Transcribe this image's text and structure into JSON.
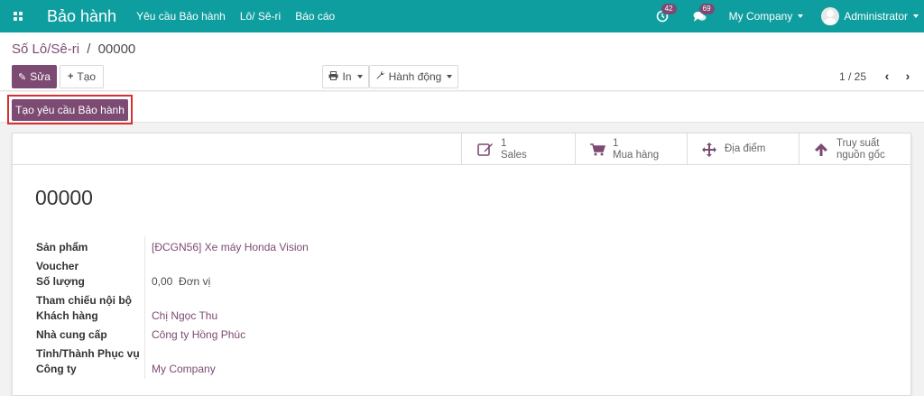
{
  "navbar": {
    "brand": "Bảo hành",
    "menu": [
      "Yêu cầu Bảo hành",
      "Lô/ Sê-ri",
      "Báo cáo"
    ],
    "activity_count": "42",
    "message_count": "69",
    "company": "My Company",
    "user": "Administrator"
  },
  "breadcrumb": {
    "parent": "Số Lô/Sê-ri",
    "separator": "/",
    "current": "00000"
  },
  "toolbar": {
    "edit_label": "Sửa",
    "create_label": "Tạo",
    "print_label": "In",
    "action_label": "Hành động"
  },
  "pager": {
    "value": "1 / 25"
  },
  "header_action": {
    "label": "Tạo yêu cầu Bảo hành"
  },
  "smart_buttons": [
    {
      "icon": "pencil-square-icon",
      "count": "1",
      "label": "Sales"
    },
    {
      "icon": "shopping-cart-icon",
      "count": "1",
      "label": "Mua hàng"
    },
    {
      "icon": "arrows-icon",
      "label": "Địa điểm"
    },
    {
      "icon": "arrow-up-icon",
      "label_line1": "Truy suất",
      "label_line2": "nguồn gốc"
    }
  ],
  "record": {
    "title": "00000"
  },
  "fields": [
    {
      "label": "Sản phẩm",
      "value": "[ĐCGN56] Xe máy Honda Vision",
      "link": true
    },
    {
      "label": "Voucher",
      "value": ""
    },
    {
      "label": "Số lượng",
      "value": "0,00  Đơn vị",
      "link": false
    },
    {
      "label": "Tham chiếu nội bộ",
      "value": ""
    },
    {
      "label": "Khách hàng",
      "value": "Chị Ngọc Thu",
      "link": true
    },
    {
      "label": "Nhà cung cấp",
      "value": "Công ty Hồng Phúc",
      "link": true
    },
    {
      "label": "Tỉnh/Thành Phục vụ",
      "value": ""
    },
    {
      "label": "Công ty",
      "value": "My Company",
      "link": true
    }
  ],
  "colors": {
    "navbar": "#0f9e9f",
    "primary": "#7c4a72",
    "highlight": "#d9302f"
  }
}
